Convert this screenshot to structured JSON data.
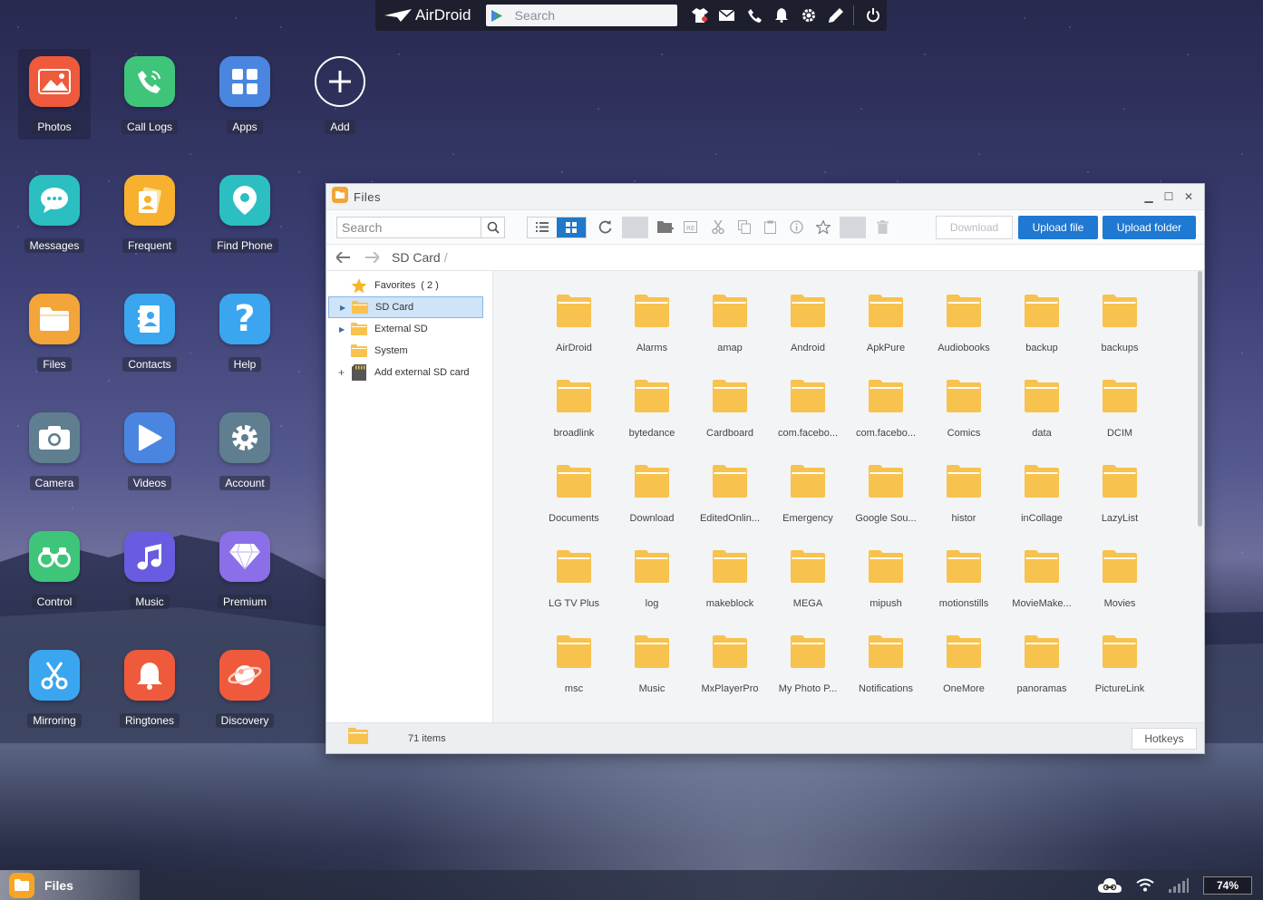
{
  "topbar": {
    "brand": "AirDroid",
    "search_placeholder": "Search",
    "icons": [
      "tshirt-icon",
      "mail-icon",
      "phone-icon",
      "bell-icon",
      "gear-icon",
      "edit-icon",
      "power-icon"
    ]
  },
  "desktop": {
    "icons": [
      {
        "label": "Photos",
        "icon": "photos-icon",
        "color": "#ef5a3c"
      },
      {
        "label": "Call Logs",
        "icon": "phone-icon",
        "color": "#3fc57a"
      },
      {
        "label": "Apps",
        "icon": "apps-icon",
        "color": "#4a86e0"
      },
      {
        "label": "Add",
        "icon": "plus-icon",
        "color": "#ffffff"
      },
      {
        "label": "Messages",
        "icon": "chat-icon",
        "color": "#2bbfc1"
      },
      {
        "label": "Frequent",
        "icon": "frequent-icon",
        "color": "#f7b12e"
      },
      {
        "label": "Find Phone",
        "icon": "location-icon",
        "color": "#2bbfc1"
      },
      {
        "label": "Files",
        "icon": "folder-icon",
        "color": "#f3a53a"
      },
      {
        "label": "Contacts",
        "icon": "contacts-icon",
        "color": "#3aa6ef"
      },
      {
        "label": "Help",
        "icon": "question-icon",
        "color": "#3aa6ef"
      },
      {
        "label": "Camera",
        "icon": "camera-icon",
        "color": "#5f7e8f"
      },
      {
        "label": "Videos",
        "icon": "play-icon",
        "color": "#4a86e0"
      },
      {
        "label": "Account",
        "icon": "gear-icon",
        "color": "#5f7e8f"
      },
      {
        "label": "Control",
        "icon": "binoculars-icon",
        "color": "#3fc57a"
      },
      {
        "label": "Music",
        "icon": "music-icon",
        "color": "#6a5ce0"
      },
      {
        "label": "Premium",
        "icon": "diamond-icon",
        "color": "#8a6fe8"
      },
      {
        "label": "Mirroring",
        "icon": "scissors-icon",
        "color": "#3aa6ef"
      },
      {
        "label": "Ringtones",
        "icon": "bell-icon",
        "color": "#ef5a3c"
      },
      {
        "label": "Discovery",
        "icon": "planet-icon",
        "color": "#ef5a3c"
      }
    ]
  },
  "files_window": {
    "title": "Files",
    "search_placeholder": "Search",
    "download_label": "Download",
    "upload_file_label": "Upload file",
    "upload_folder_label": "Upload folder",
    "breadcrumb": "SD Card",
    "breadcrumb_sep": "/",
    "tree": [
      {
        "label": "Favorites",
        "count": "( 2 )",
        "icon": "star-icon",
        "arrow": ""
      },
      {
        "label": "SD Card",
        "icon": "folder-icon",
        "arrow": "▶",
        "selected": true
      },
      {
        "label": "External SD",
        "icon": "folder-icon",
        "arrow": "▶"
      },
      {
        "label": "System",
        "icon": "folder-icon",
        "arrow": ""
      },
      {
        "label": "Add external SD card",
        "icon": "sdcard-icon",
        "arrow": "+"
      }
    ],
    "folders": [
      "AirDroid",
      "Alarms",
      "amap",
      "Android",
      "ApkPure",
      "Audiobooks",
      "backup",
      "backups",
      "broadlink",
      "bytedance",
      "Cardboard",
      "com.facebo...",
      "com.facebo...",
      "Comics",
      "data",
      "DCIM",
      "Documents",
      "Download",
      "EditedOnlin...",
      "Emergency",
      "Google Sou...",
      "histor",
      "inCollage",
      "LazyList",
      "LG TV Plus",
      "log",
      "makeblock",
      "MEGA",
      "mipush",
      "motionstills",
      "MovieMake...",
      "Movies",
      "msc",
      "Music",
      "MxPlayerPro",
      "My Photo P...",
      "Notifications",
      "OneMore",
      "panoramas",
      "PictureLink"
    ],
    "status_count": "71 items",
    "hotkeys_label": "Hotkeys",
    "accent": "#1f78d1",
    "folder_color": "#f8c24e"
  },
  "taskbar": {
    "app_label": "Files",
    "battery": "74%"
  }
}
